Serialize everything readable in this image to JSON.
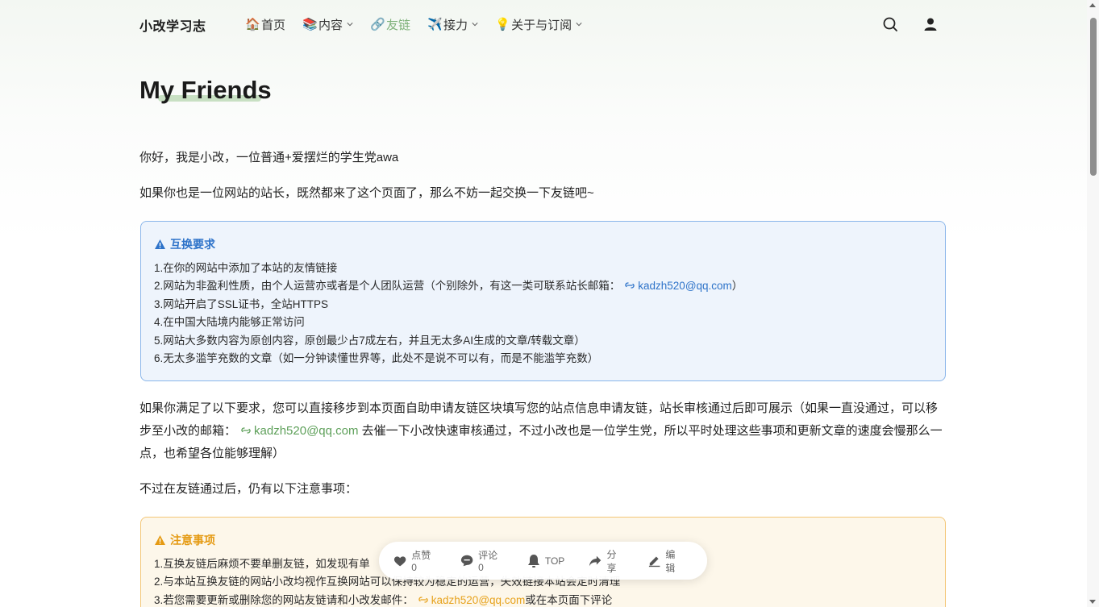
{
  "header": {
    "brand": "小改学习志",
    "nav": [
      {
        "emoji": "🏠",
        "label": "首页"
      },
      {
        "emoji": "📚",
        "label": "内容"
      },
      {
        "emoji": "🔗",
        "label": "友链"
      },
      {
        "emoji": "✈️",
        "label": "接力"
      },
      {
        "emoji": "💡",
        "label": "关于与订阅"
      }
    ],
    "icons": [
      "search-icon",
      "user-icon"
    ]
  },
  "page": {
    "title": "My Friends",
    "intro1": "你好，我是小改，一位普通+爱摆烂的学生党awa",
    "intro2": "如果你也是一位网站的站长，既然都来了这个页面了，那么不妨一起交换一下友链吧~",
    "para3_a": "如果你满足了以下要求，您可以直接移步到本页面自助申请友链区块填写您的站点信息申请友链，站长审核通过后即可展示（如果一直没通过，可以移步至小改的邮箱：",
    "para3_mail": "kadzh520@qq.com",
    "para3_b": " 去催一下小改快速审核通过，不过小改也是一位学生党，所以平时处理这些事项和更新文章的速度会慢那么一点，也希望各位能够理解）",
    "para4": "不过在友链通过后，仍有以下注意事项："
  },
  "requirements": {
    "title": "互换要求",
    "items": [
      "1.在你的网站中添加了本站的友情链接",
      "2.网站为非盈利性质，由个人运营亦或者是个人团队运营（个别除外，有这一类可联系站长邮箱：",
      "3.网站开启了SSL证书，全站HTTPS",
      "4.在中国大陆境内能够正常访问",
      "5.网站大多数内容为原创内容，原创最少占7成左右，并且无太多AI生成的文章/转载文章）",
      "6.无太多滥竽充数的文章（如一分钟读懂世界等，此处不是说不可以有，而是不能滥竽充数）"
    ],
    "mail": "kadzh520@qq.com",
    "mail_close": "）"
  },
  "notes": {
    "title": "注意事项",
    "items": [
      "1.互换友链后麻烦不要单删友链，如发现有单",
      "2.与本站互换友链的网站小改均视作互换网站可以保持较为稳定的运营，失效链接本站会定时清理",
      "3.若您需要更新或删除您的网站友链请和小改发邮件："
    ],
    "mail": "kadzh520@qq.com",
    "mail_tail": "或在本页面下评论"
  },
  "floatbar": {
    "like": "点赞 0",
    "comment": "评论 0",
    "top": "TOP",
    "share": "分享",
    "edit": "编辑"
  },
  "colors": {
    "accent_green": "#7fb27a",
    "info_blue": "#2e73c9",
    "warn_orange": "#e59a12"
  }
}
